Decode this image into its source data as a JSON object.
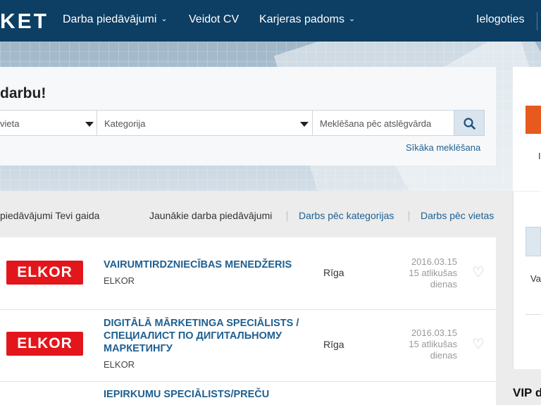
{
  "nav": {
    "logo_text": "KET",
    "items": [
      {
        "label": "Darba piedāvājumi",
        "has_chevron": true
      },
      {
        "label": "Veidot CV",
        "has_chevron": false
      },
      {
        "label": "Karjeras padoms",
        "has_chevron": true
      }
    ],
    "login_label": "Ielogoties"
  },
  "search": {
    "title": "darbu!",
    "location_value": "vieta",
    "category_value": "Kategorija",
    "keyword_placeholder": "Meklēšana pēc atslēgvārda",
    "advanced_link": "Sīkāka meklēšana"
  },
  "tabs": {
    "intro": "piedāvājumi Tevi gaida",
    "items": [
      {
        "label": "Jaunākie darba piedāvājumi",
        "active": true
      },
      {
        "label": "Darbs pēc kategorijas",
        "active": false
      },
      {
        "label": "Darbs pēc vietas",
        "active": false
      }
    ]
  },
  "listings": [
    {
      "logo_text": "ELKOR",
      "title": "VAIRUMTIRDZNIECĪBAS MENEDŽERIS",
      "company": "ELKOR",
      "city": "Rīga",
      "date": "2016.03.15",
      "days_left": "15 atlikušas dienas"
    },
    {
      "logo_text": "ELKOR",
      "title": "DIGITĀLĀ MĀRKETINGA SPECIĀLISTS / СПЕЦИАЛИСТ ПО ДИГИТАЛЬНОМУ МАРКЕТИНГУ",
      "company": "ELKOR",
      "city": "Rīga",
      "date": "2016.03.15",
      "days_left": "15 atlikušas dienas"
    },
    {
      "title": "IEPIRKUMU SPECIĀLISTS/PREČU"
    }
  ],
  "sidebar": {
    "fragment_i": "I",
    "fragment_va": "Va",
    "vip_fragment": "VIP d"
  },
  "colors": {
    "nav_bg": "#0d3e63",
    "link": "#1e5f91",
    "cta_orange": "#e65a1e",
    "logo_red": "#e3161b"
  },
  "icons": {
    "search": "search-icon",
    "chevron": "chevron-down-icon",
    "caret": "caret-down-icon",
    "heart": "heart-icon"
  }
}
